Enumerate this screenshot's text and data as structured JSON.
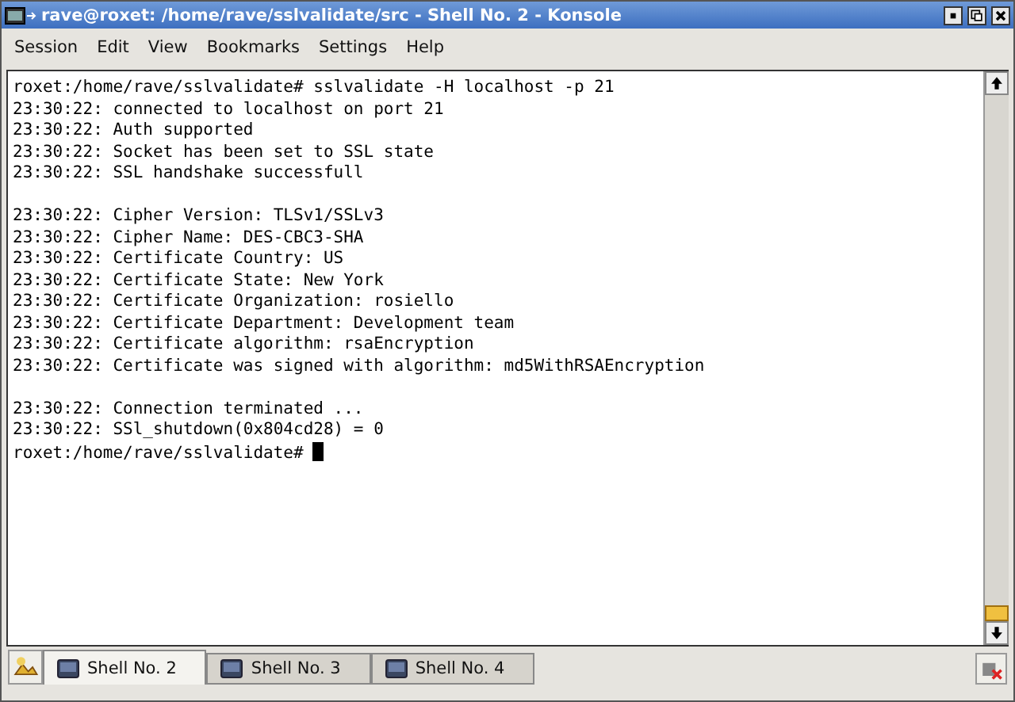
{
  "window": {
    "title": "rave@roxet: /home/rave/sslvalidate/src - Shell No. 2 - Konsole"
  },
  "menu": [
    "Session",
    "Edit",
    "View",
    "Bookmarks",
    "Settings",
    "Help"
  ],
  "terminal": {
    "blocks": [
      [
        "roxet:/home/rave/sslvalidate# sslvalidate -H localhost -p 21",
        "23:30:22: connected to localhost on port 21",
        "23:30:22: Auth supported",
        "23:30:22: Socket has been set to SSL state",
        "23:30:22: SSL handshake successfull"
      ],
      [
        "23:30:22: Cipher Version: TLSv1/SSLv3",
        "23:30:22: Cipher Name: DES-CBC3-SHA",
        "23:30:22: Certificate Country: US",
        "23:30:22: Certificate State: New York",
        "23:30:22: Certificate Organization: rosiello",
        "23:30:22: Certificate Department: Development team",
        "23:30:22: Certificate algorithm: rsaEncryption",
        "23:30:22: Certificate was signed with algorithm: md5WithRSAEncryption"
      ],
      [
        "23:30:22: Connection terminated ...",
        "23:30:22: SSl_shutdown(0x804cd28) = 0"
      ]
    ],
    "prompt": "roxet:/home/rave/sslvalidate#",
    "cursor": true
  },
  "tabs": [
    {
      "label": "Shell No. 2",
      "selected": true
    },
    {
      "label": "Shell No. 3",
      "selected": false
    },
    {
      "label": "Shell No. 4",
      "selected": false
    }
  ]
}
